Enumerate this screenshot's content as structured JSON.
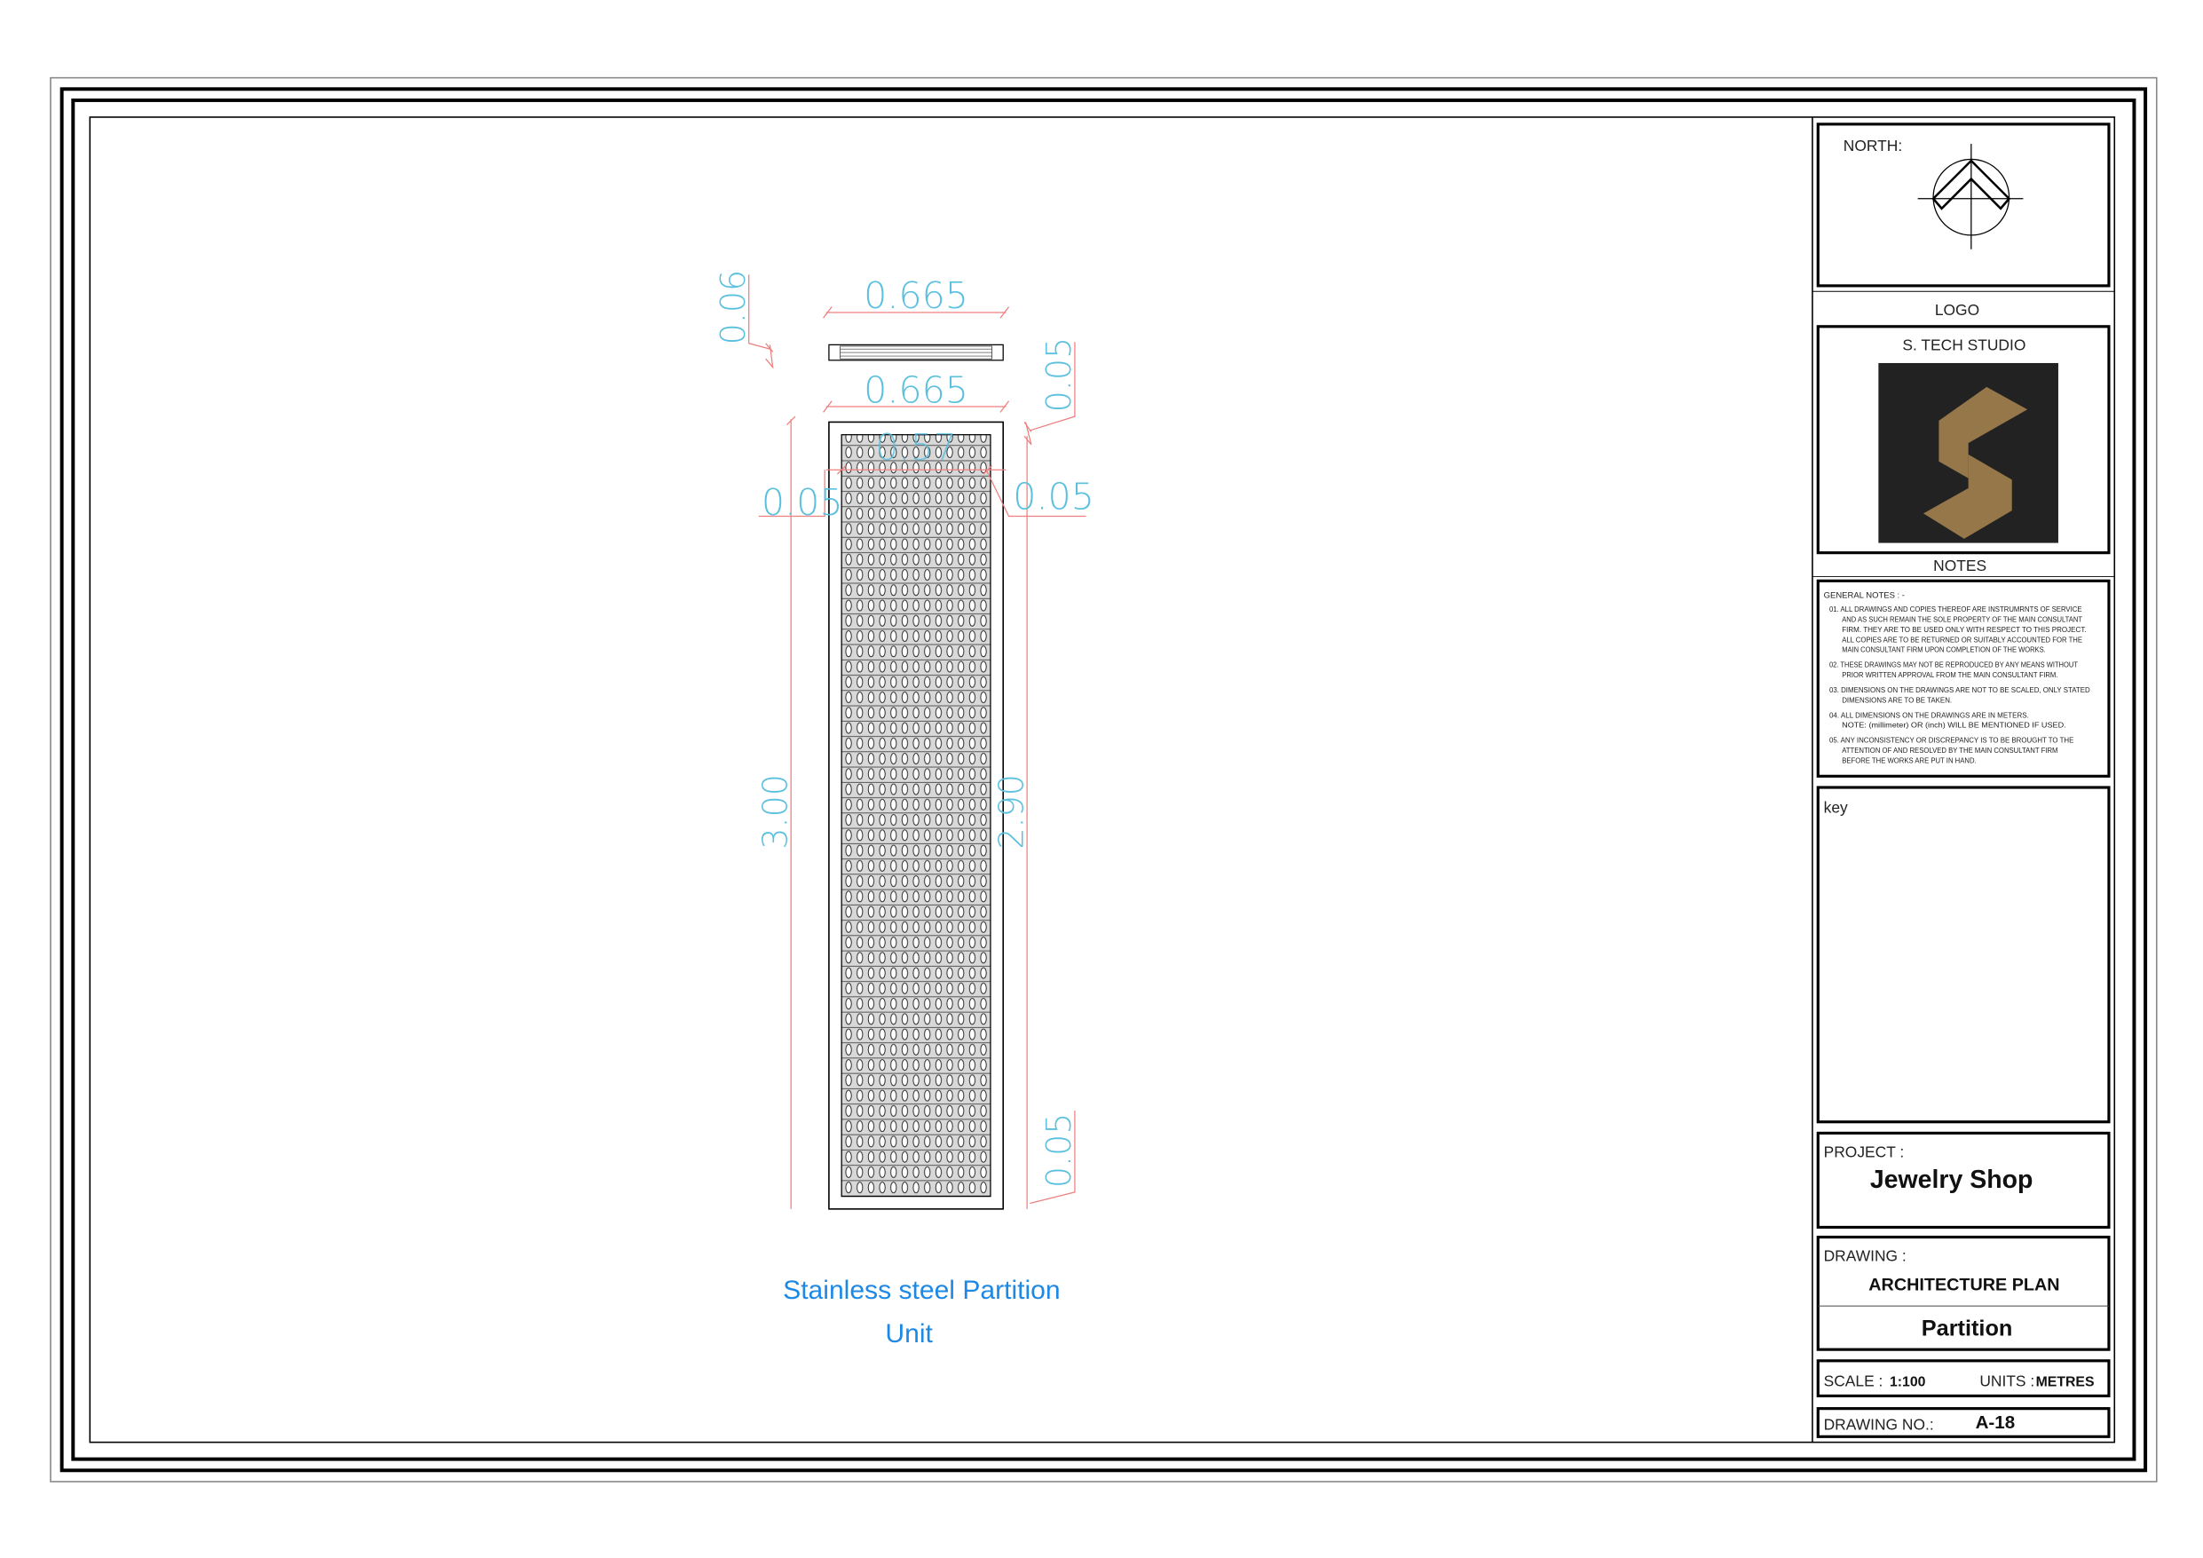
{
  "drawing": {
    "dimensions": {
      "top_thickness": "0.06",
      "top_width": "0.665",
      "panel_width": "0.665",
      "inner_width": "0.57",
      "right_top_offset": "0.05",
      "left_side": "0.05",
      "right_side": "0.05",
      "total_height": "3.00",
      "inner_height": "2.90",
      "bottom_offset": "0.05"
    },
    "caption_line1": "Stainless steel  Partition",
    "caption_line2": "Unit",
    "colors": {
      "dimension_text": "#5bc0de",
      "dimension_line": "#ef7f7f",
      "caption": "#1e88e5"
    }
  },
  "title_block": {
    "north_label": "NORTH:",
    "logo_label": "LOGO",
    "studio_name": "S. TECH STUDIO",
    "logo_colors": {
      "background": "#222222",
      "mark": "#957749"
    },
    "notes_label": "NOTES",
    "general_notes_title": "GENERAL NOTES : -",
    "notes": [
      {
        "lines": [
          "01. ALL DRAWINGS AND COPIES THEREOF ARE INSTRUMRNTS OF SERVICE",
          "AND AS SUCH REMAIN THE SOLE PROPERTY OF THE MAIN CONSULTANT",
          "FIRM. THEY ARE TO BE USED ONLY WITH RESPECT TO THIS PROJECT.",
          "ALL COPIES ARE TO BE RETURNED OR SUITABLY ACCOUNTED FOR THE",
          "MAIN CONSULTANT FIRM UPON COMPLETION OF THE WORKS."
        ]
      },
      {
        "lines": [
          "02. THESE DRAWINGS MAY NOT BE REPRODUCED BY ANY MEANS WITHOUT",
          "PRIOR WRITTEN APPROVAL FROM THE MAIN CONSULTANT FIRM."
        ]
      },
      {
        "lines": [
          "03. DIMENSIONS ON THE DRAWINGS ARE NOT TO BE SCALED, ONLY STATED",
          "DIMENSIONS ARE TO BE TAKEN."
        ]
      },
      {
        "lines": [
          "04. ALL DIMENSIONS ON THE DRAWINGS ARE IN METERS.",
          "NOTE: (millimeter) OR (inch) WILL BE MENTIONED IF USED."
        ]
      },
      {
        "lines": [
          "05. ANY INCONSISTENCY OR DISCREPANCY IS TO BE BROUGHT TO THE",
          "ATTENTION OF AND RESOLVED BY THE MAIN CONSULTANT FIRM",
          "BEFORE THE WORKS ARE PUT IN HAND."
        ]
      }
    ],
    "key_label": "key",
    "project_label": "PROJECT :",
    "project_name": "Jewelry Shop",
    "drawing_label": "DRAWING :",
    "drawing_type": "ARCHITECTURE PLAN",
    "drawing_name": "Partition",
    "scale_label": "SCALE :",
    "scale_value": "1:100",
    "units_label": "UNITS :",
    "units_value": "METRES",
    "drawing_no_label": "DRAWING NO.:",
    "drawing_no_value": "A-18"
  }
}
